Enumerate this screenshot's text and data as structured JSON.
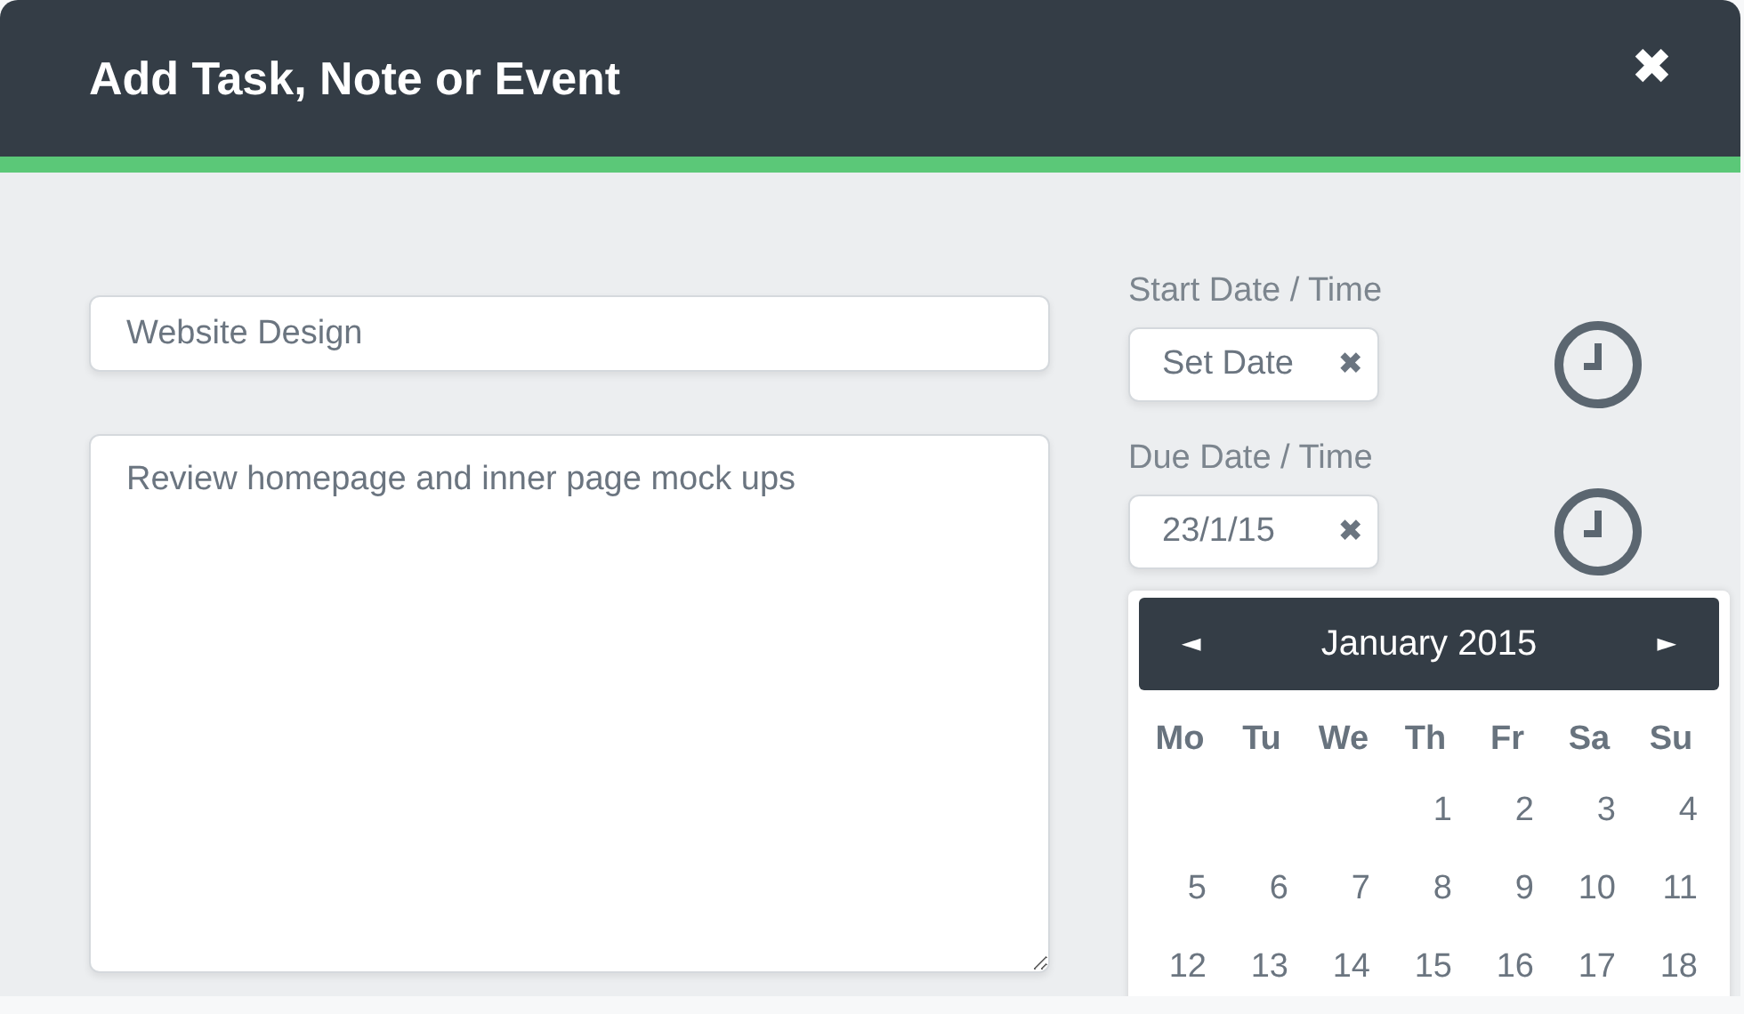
{
  "dialog": {
    "title": "Add Task, Note or Event",
    "close": "✖"
  },
  "form": {
    "title_value": "Website Design",
    "notes_value": "Review homepage and inner page mock ups"
  },
  "start": {
    "label": "Start Date / Time",
    "value": "Set Date",
    "clear": "✖"
  },
  "due": {
    "label": "Due Date / Time",
    "value": "23/1/15",
    "clear": "✖"
  },
  "calendar": {
    "prev": "◄",
    "month": "January 2015",
    "next": "►",
    "weekdays": [
      "Mo",
      "Tu",
      "We",
      "Th",
      "Fr",
      "Sa",
      "Su"
    ],
    "weeks": [
      {
        "days": [
          "1",
          "2",
          "3",
          "4"
        ]
      },
      {
        "days": [
          "5",
          "6",
          "7",
          "8",
          "9",
          "10",
          "11"
        ]
      },
      {
        "days": [
          "12",
          "13",
          "14",
          "15",
          "16",
          "17",
          "18"
        ]
      }
    ]
  }
}
